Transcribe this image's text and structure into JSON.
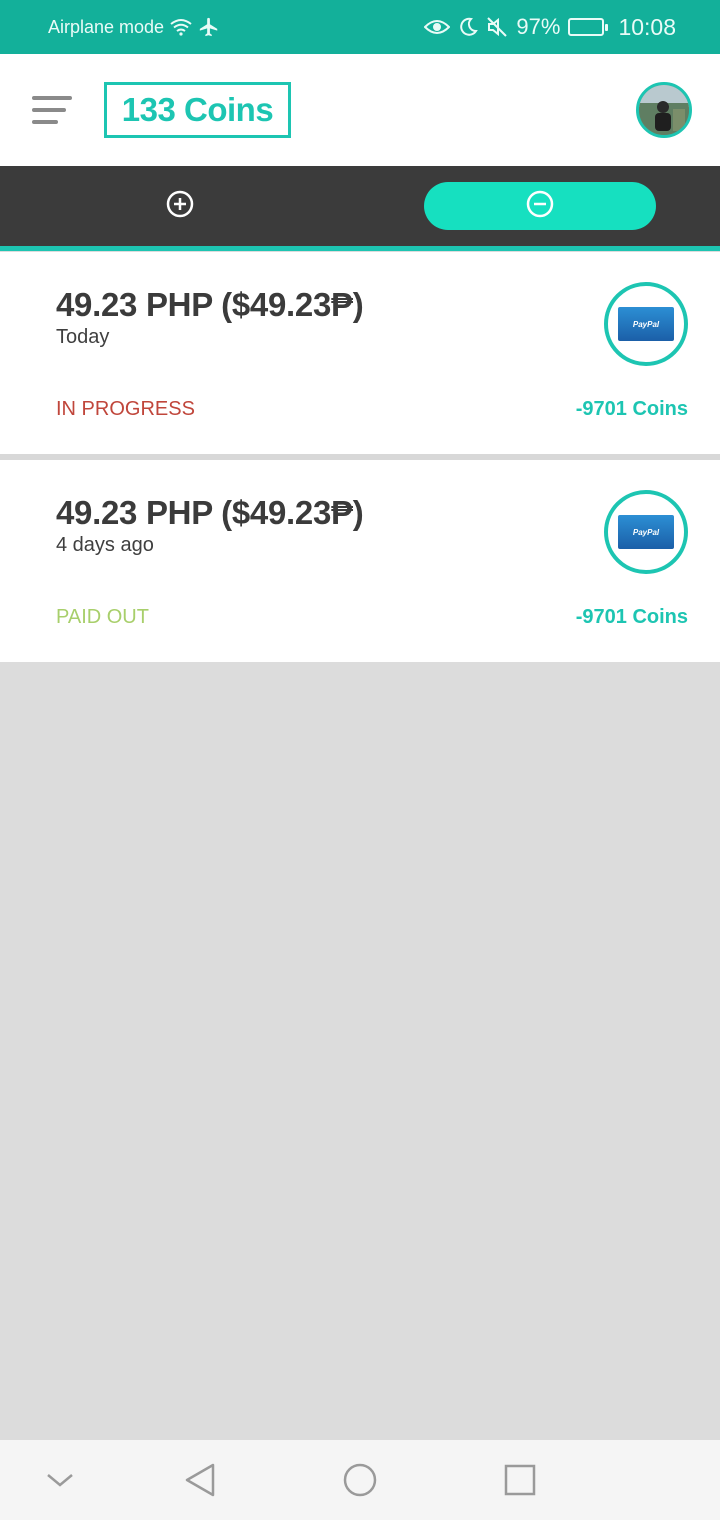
{
  "status_bar": {
    "airplane_label": "Airplane mode",
    "battery": "97%",
    "time": "10:08",
    "icons": [
      "wifi-icon",
      "airplane-icon",
      "eye-icon",
      "moon-icon",
      "mute-icon",
      "battery-icon"
    ]
  },
  "header": {
    "coins_label": "133 Coins",
    "menu_icon": "hamburger-menu-icon",
    "avatar_icon": "profile-avatar"
  },
  "tabs": {
    "add_icon": "plus-circle-icon",
    "minus_icon": "minus-circle-icon",
    "active": "minus"
  },
  "transactions": [
    {
      "amount": "49.23 PHP ($49.23₱)",
      "date": "Today",
      "status": "IN PROGRESS",
      "coins": "-9701 Coins",
      "method": "PayPal"
    },
    {
      "amount": "49.23 PHP ($49.23₱)",
      "date": "4 days ago",
      "status": "PAID OUT",
      "coins": "-9701 Coins",
      "method": "PayPal"
    }
  ],
  "nav_bar": {
    "icons": [
      "chevron-down-icon",
      "back-icon",
      "home-icon",
      "recents-icon"
    ]
  },
  "colors": {
    "status_bar": "#13b09a",
    "accent": "#1dc5b2",
    "tab_bar": "#3b3b3b",
    "in_progress": "#c0463b",
    "paid_out": "#a8cf6b"
  }
}
